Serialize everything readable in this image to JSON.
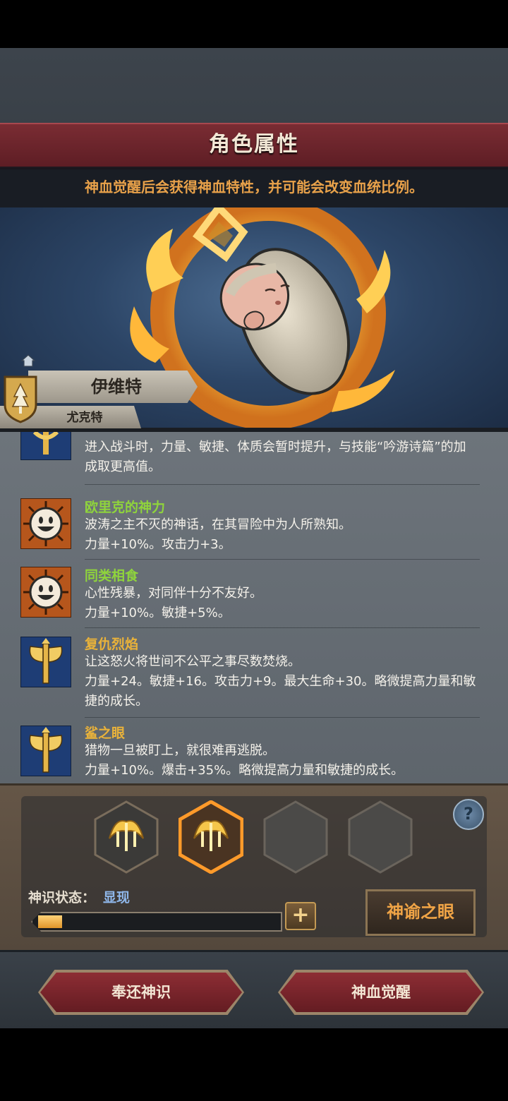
{
  "header": {
    "title": "角色属性"
  },
  "notice": {
    "text": "神血觉醒后会获得神血特性，并可能会改变血统比例。"
  },
  "character": {
    "name": "伊维特",
    "lineage": "尤克特"
  },
  "traits": [
    {
      "icon": "golden-axe-icon",
      "name": "",
      "name_color": "#8fd43c",
      "lines": [
        "进入战斗时，力量、敏捷、体质会暂时提升，与技能“吟游诗篇”的加",
        "成取更高值。"
      ]
    },
    {
      "icon": "smiling-sun-face-icon",
      "name": "欧里克的神力",
      "name_color": "#8fd43c",
      "lines": [
        "波涛之主不灭的神话，在其冒险中为人所熟知。",
        "力量+10%。攻击力+3。"
      ]
    },
    {
      "icon": "smiling-sun-face-icon",
      "name": "同类相食",
      "name_color": "#8fd43c",
      "lines": [
        "心性残暴，对同伴十分不友好。",
        "力量+10%。敏捷+5%。"
      ]
    },
    {
      "icon": "golden-axe-icon",
      "name": "复仇烈焰",
      "name_color": "#e9b23a",
      "lines": [
        "让这怒火将世间不公平之事尽数焚烧。",
        "力量+24。敏捷+16。攻击力+9。最大生命+30。略微提高力量和敏",
        "捷的成长。"
      ]
    },
    {
      "icon": "golden-axe-icon",
      "name": "鲨之眼",
      "name_color": "#e9b23a",
      "lines": [
        "猎物一旦被盯上，就很难再逃脱。",
        "力量+10%。爆击+35%。略微提高力量和敏捷的成长。"
      ]
    }
  ],
  "divine_sense": {
    "status_label": "神识状态：",
    "status_value": "显现",
    "progress": 0.1,
    "slots": [
      {
        "icon": "golden-trident-flame-icon",
        "filled": true,
        "selected": false
      },
      {
        "icon": "golden-trident-flame-icon",
        "filled": true,
        "selected": true
      },
      {
        "icon": "",
        "filled": false,
        "selected": false
      },
      {
        "icon": "",
        "filled": false,
        "selected": false
      }
    ],
    "plus_label": "+",
    "oracle_button": "神谕之眼",
    "help_label": "?"
  },
  "footer": {
    "return_button": "奉还神识",
    "awaken_button": "神血觉醒"
  }
}
